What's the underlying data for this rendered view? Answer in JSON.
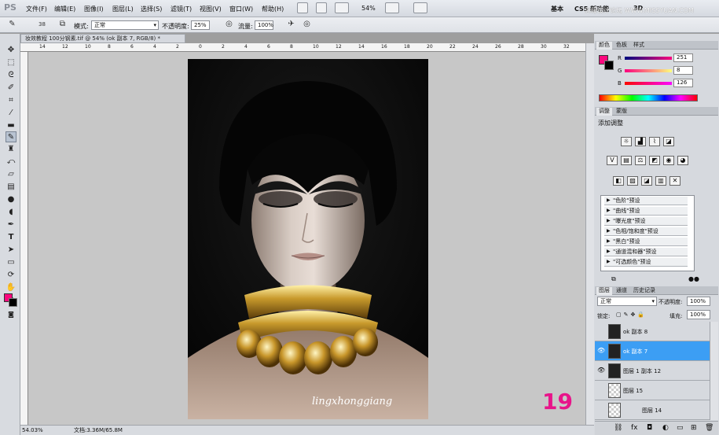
{
  "app": {
    "logo": "PS"
  },
  "menubar": {
    "items": [
      "文件(F)",
      "编辑(E)",
      "图像(I)",
      "图层(L)",
      "选择(S)",
      "滤镜(T)",
      "视图(V)",
      "窗口(W)",
      "帮助(H)"
    ],
    "zoom": "54%",
    "workspace_basic": "基本",
    "workspace_cs5": "CS5 新功能",
    "workspace_3d": "3D",
    "watermark": "思缘设计论坛 WWW.MISSYUAN.COM"
  },
  "options": {
    "brush_size": "38",
    "mode_label": "模式:",
    "mode_value": "正常",
    "opacity_label": "不透明度:",
    "opacity_value": "25%",
    "flow_label": "流量:",
    "flow_value": "100%"
  },
  "document": {
    "tab_title": "妆效教程 100分钢素.tif @ 54% (ok 副本 7, RGB/8) *",
    "zoom_status": "54.03%",
    "doc_size": "文档:3.36M/65.8M",
    "signature": "lingxhonggiang",
    "corner_mark": "19"
  },
  "ruler_h": [
    "14",
    "12",
    "10",
    "8",
    "6",
    "4",
    "2",
    "0",
    "2",
    "4",
    "6",
    "8",
    "10",
    "12",
    "14",
    "16",
    "18",
    "20",
    "22",
    "24",
    "26",
    "28",
    "30",
    "32"
  ],
  "color_panel": {
    "tabs": [
      "颜色",
      "色板",
      "样式"
    ],
    "r_label": "R",
    "g_label": "G",
    "b_label": "B",
    "r": "251",
    "g": "8",
    "b": "126",
    "foreground": "#fb087e",
    "background": "#000000"
  },
  "adjust_panel": {
    "tabs": [
      "调整",
      "蒙版"
    ],
    "title": "添加调整",
    "presets": [
      "\"色阶\"预设",
      "\"曲线\"预设",
      "\"曝光度\"预设",
      "\"色相/饱和度\"预设",
      "\"黑白\"预设",
      "\"通道混和器\"预设",
      "\"可选颜色\"预设"
    ]
  },
  "layers_panel": {
    "tabs": [
      "图层",
      "通道",
      "历史记录"
    ],
    "blend_mode": "正常",
    "opacity_label": "不透明度:",
    "opacity_value": "100%",
    "lock_label": "锁定:",
    "fill_label": "填充:",
    "fill_value": "100%",
    "layers": [
      {
        "name": "ok 副本 8",
        "visible": false,
        "selected": false
      },
      {
        "name": "ok 副本 7",
        "visible": true,
        "selected": true
      },
      {
        "name": "图层 1 副本 12",
        "visible": true,
        "selected": false
      },
      {
        "name": "图层 15",
        "visible": false,
        "selected": false
      },
      {
        "name": "图层 14",
        "visible": false,
        "selected": false
      }
    ]
  }
}
